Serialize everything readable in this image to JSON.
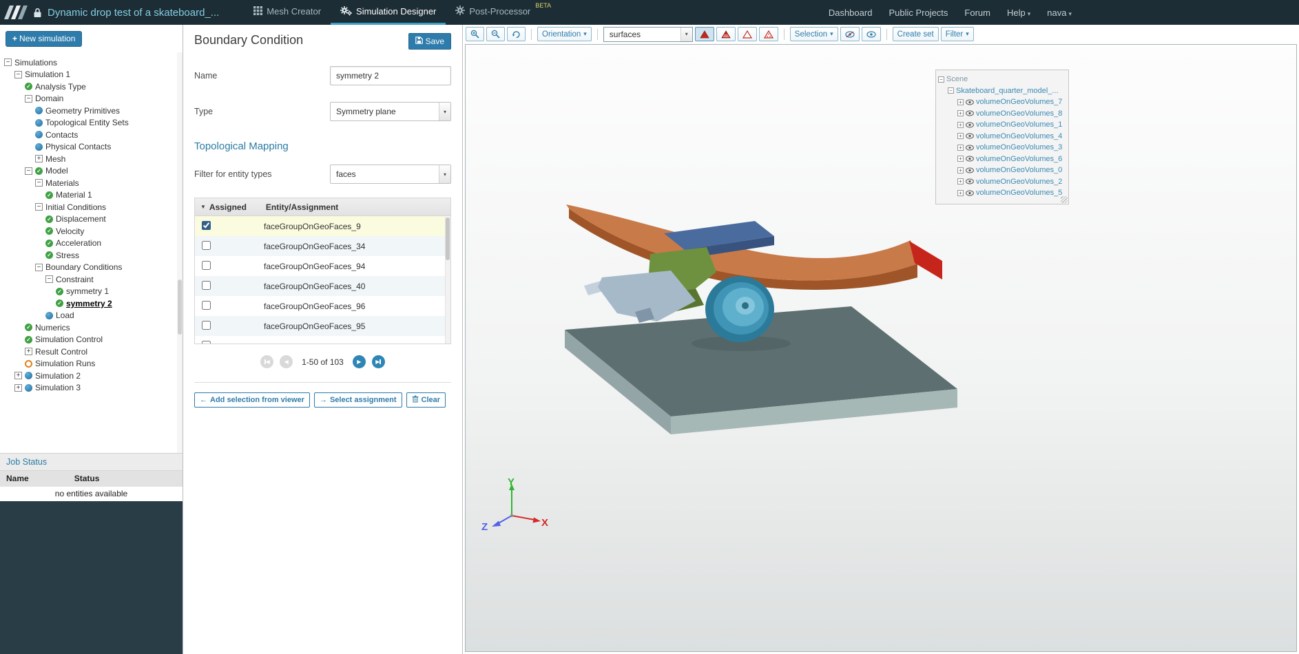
{
  "colors": {
    "accent": "#2e7cab",
    "topbar_bg": "#1c2d35",
    "tab_active_underline": "#3e9dc4",
    "status_complete": "#3fa143",
    "status_neutral": "#2d7fb0",
    "status_pending": "#e0801f",
    "checked_row_bg": "#fbfbdf",
    "render_mode_red": "#c4281c",
    "section_title_color": "#2b7ca3"
  },
  "header": {
    "project_title": "Dynamic drop test of a skateboard_...",
    "tabs": [
      {
        "label": "Mesh Creator"
      },
      {
        "label": "Simulation Designer",
        "active": true
      },
      {
        "label": "Post-Processor",
        "badge": "BETA"
      }
    ],
    "links": [
      {
        "label": "Dashboard"
      },
      {
        "label": "Public Projects"
      },
      {
        "label": "Forum"
      },
      {
        "label": "Help",
        "caret": true
      },
      {
        "label": "nava",
        "caret": true
      }
    ]
  },
  "sidebar": {
    "new_simulation_label": "New simulation",
    "tree": [
      {
        "label": "Simulations",
        "depth": 0,
        "expander": "minus",
        "status": null
      },
      {
        "label": "Simulation 1",
        "depth": 1,
        "expander": "minus",
        "status": null
      },
      {
        "label": "Analysis Type",
        "depth": 2,
        "expander": null,
        "status": "check"
      },
      {
        "label": "Domain",
        "depth": 2,
        "expander": "minus",
        "status": null
      },
      {
        "label": "Geometry Primitives",
        "depth": 3,
        "expander": null,
        "status": "dot"
      },
      {
        "label": "Topological Entity Sets",
        "depth": 3,
        "expander": null,
        "status": "dot"
      },
      {
        "label": "Contacts",
        "depth": 3,
        "expander": null,
        "status": "dot"
      },
      {
        "label": "Physical Contacts",
        "depth": 3,
        "expander": null,
        "status": "dot"
      },
      {
        "label": "Mesh",
        "depth": 3,
        "expander": "plus",
        "status": null
      },
      {
        "label": "Model",
        "depth": 2,
        "expander": "minus",
        "status": "check"
      },
      {
        "label": "Materials",
        "depth": 3,
        "expander": "minus",
        "status": null
      },
      {
        "label": "Material 1",
        "depth": 4,
        "expander": null,
        "status": "check"
      },
      {
        "label": "Initial Conditions",
        "depth": 3,
        "expander": "minus",
        "status": null
      },
      {
        "label": "Displacement",
        "depth": 4,
        "expander": null,
        "status": "check"
      },
      {
        "label": "Velocity",
        "depth": 4,
        "expander": null,
        "status": "check"
      },
      {
        "label": "Acceleration",
        "depth": 4,
        "expander": null,
        "status": "check"
      },
      {
        "label": "Stress",
        "depth": 4,
        "expander": null,
        "status": "check"
      },
      {
        "label": "Boundary Conditions",
        "depth": 3,
        "expander": "minus",
        "status": null
      },
      {
        "label": "Constraint",
        "depth": 4,
        "expander": "minus",
        "status": null
      },
      {
        "label": "symmetry 1",
        "depth": 5,
        "expander": null,
        "status": "check"
      },
      {
        "label": "symmetry 2",
        "depth": 5,
        "expander": null,
        "status": "check",
        "selected": true
      },
      {
        "label": "Load",
        "depth": 4,
        "expander": null,
        "status": "dot"
      },
      {
        "label": "Numerics",
        "depth": 2,
        "expander": null,
        "status": "check"
      },
      {
        "label": "Simulation Control",
        "depth": 2,
        "expander": null,
        "status": "check"
      },
      {
        "label": "Result Control",
        "depth": 2,
        "expander": "plus",
        "status": null
      },
      {
        "label": "Simulation Runs",
        "depth": 2,
        "expander": null,
        "status": "circle"
      },
      {
        "label": "Simulation 2",
        "depth": 1,
        "expander": "plus",
        "status": "dot"
      },
      {
        "label": "Simulation 3",
        "depth": 1,
        "expander": "plus",
        "status": "dot"
      }
    ],
    "job_status": {
      "title": "Job Status",
      "name_col": "Name",
      "status_col": "Status",
      "empty_message": "no entities available"
    }
  },
  "panel": {
    "title": "Boundary Condition",
    "save_label": "Save",
    "name_label": "Name",
    "name_value": "symmetry 2",
    "type_label": "Type",
    "type_value": "Symmetry plane",
    "section_title": "Topological Mapping",
    "filter_label": "Filter for entity types",
    "filter_value": "faces",
    "table": {
      "assigned_col": "Assigned",
      "entity_col": "Entity/Assignment",
      "rows": [
        {
          "name": "faceGroupOnGeoFaces_9",
          "checked": true
        },
        {
          "name": "faceGroupOnGeoFaces_34",
          "checked": false
        },
        {
          "name": "faceGroupOnGeoFaces_94",
          "checked": false
        },
        {
          "name": "faceGroupOnGeoFaces_40",
          "checked": false
        },
        {
          "name": "faceGroupOnGeoFaces_96",
          "checked": false
        },
        {
          "name": "faceGroupOnGeoFaces_95",
          "checked": false
        }
      ]
    },
    "pagination_label": "1-50 of 103",
    "actions": {
      "add_selection": "Add selection from viewer",
      "select_assignment": "Select assignment",
      "clear": "Clear"
    }
  },
  "viewer": {
    "toolbar": {
      "orientation_label": "Orientation",
      "display_mode_value": "surfaces",
      "selection_label": "Selection",
      "create_set_label": "Create set",
      "filter_label": "Filter"
    },
    "scene_tree": {
      "root_label": "Scene",
      "model_label": "Skateboard_quarter_model_...",
      "volumes": [
        "volumeOnGeoVolumes_7",
        "volumeOnGeoVolumes_8",
        "volumeOnGeoVolumes_1",
        "volumeOnGeoVolumes_4",
        "volumeOnGeoVolumes_3",
        "volumeOnGeoVolumes_6",
        "volumeOnGeoVolumes_0",
        "volumeOnGeoVolumes_2",
        "volumeOnGeoVolumes_5"
      ]
    },
    "axes": {
      "x": "X",
      "y": "Y",
      "z": "Z"
    }
  }
}
